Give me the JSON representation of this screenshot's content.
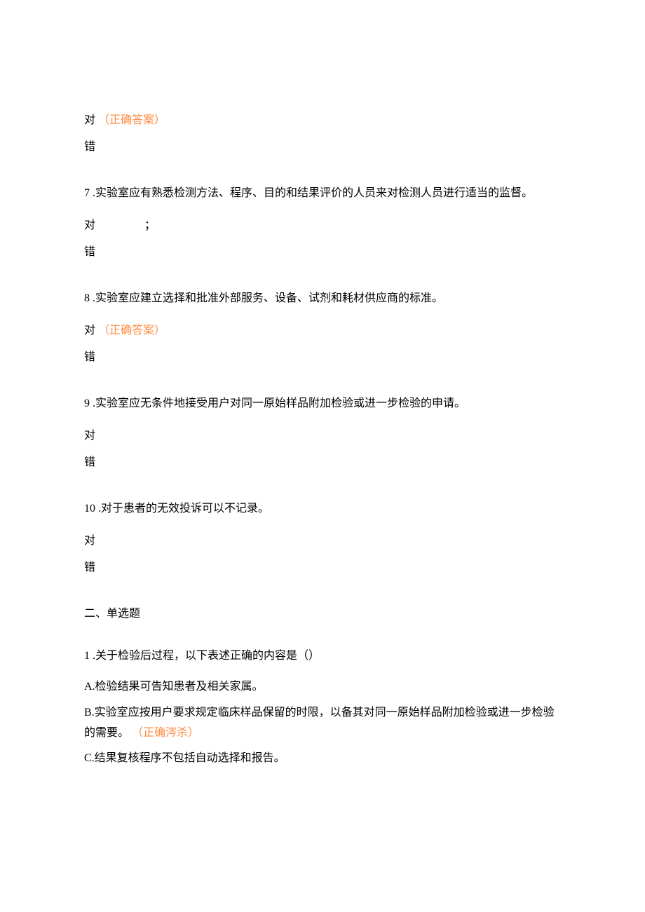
{
  "q6": {
    "opt_true": "对",
    "correct_label": "（正确答案）",
    "opt_false": "错"
  },
  "q7": {
    "number": "7",
    "sep": " .",
    "text": "实验室应有熟悉检测方法、程序、目的和结果评价的人员来对检测人员进行适当的监督。",
    "opt_true": "对",
    "punct": "；",
    "opt_false": "错"
  },
  "q8": {
    "number": "8",
    "sep": " .",
    "text": "实验室应建立选择和批准外部服务、设备、试剂和耗材供应商的标准。",
    "opt_true": "对",
    "correct_label": "（正确答案）",
    "opt_false": "错"
  },
  "q9": {
    "number": "9",
    "sep": " .",
    "text": "实验室应无条件地接受用户对同一原始样品附加检验或进一步检验的申请。",
    "opt_true": "对",
    "opt_false": "错"
  },
  "q10": {
    "number": "10",
    "sep": " .",
    "text": "对于患者的无效投诉可以不记录。",
    "opt_true": "对",
    "opt_false": "错"
  },
  "section2": {
    "header": "二、单选题"
  },
  "s2q1": {
    "number": "1",
    "sep": " .",
    "text": "关于检验后过程，以下表述正确的内容是（）",
    "optA": "A.检验结果可告知患者及相关家属。",
    "optB": "B.实验室应按用户要求规定临床样品保留的时限，以备其对同一原始样品附加检验或进一步检验的需要。",
    "optB_correct": "（正确涔杀）",
    "optC": "C.结果复核程序不包括自动选择和报告。"
  }
}
